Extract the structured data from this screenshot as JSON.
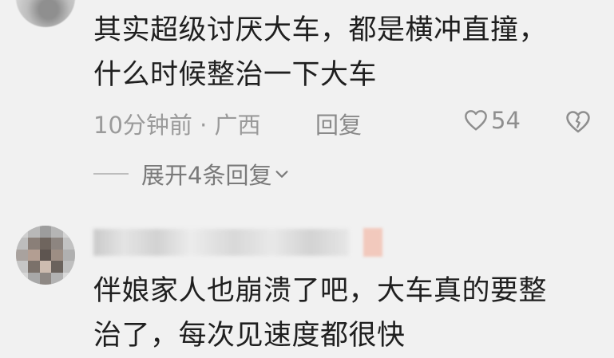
{
  "comments": [
    {
      "text": "其实超级讨厌大车，都是横冲直撞，\n什么时候整治一下大车",
      "time_location": "10分钟前 · 广西",
      "reply_label": "回复",
      "likes": "54",
      "expand_label": "展开4条回复"
    },
    {
      "text": "伴娘家人也崩溃了吧，大车真的要整\n治了，每次见速度都很快"
    }
  ],
  "icons": {
    "like": "heart-icon",
    "dislike": "dislike-heart-icon",
    "expand": "chevron-down-icon"
  },
  "colors": {
    "background": "#f1f1f1",
    "primary_text": "#1f1f1f",
    "meta_text": "#9a9a9a"
  }
}
